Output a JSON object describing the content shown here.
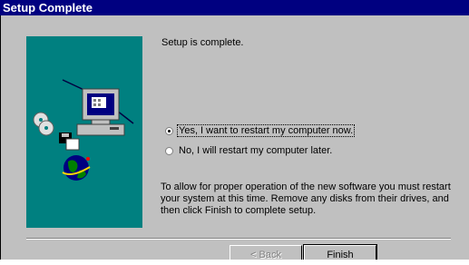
{
  "window": {
    "title": "Setup Complete"
  },
  "message": {
    "heading": "Setup is complete."
  },
  "options": [
    {
      "label": "Yes, I want to restart my computer now.",
      "checked": true
    },
    {
      "label": "No, I will restart my computer later.",
      "checked": false
    }
  ],
  "info": "To allow for proper operation of the new software you must restart your system at this time.  Remove any disks from their drives, and then click Finish to complete setup.",
  "buttons": {
    "back_label": "< Back",
    "finish_label": "Finish"
  }
}
